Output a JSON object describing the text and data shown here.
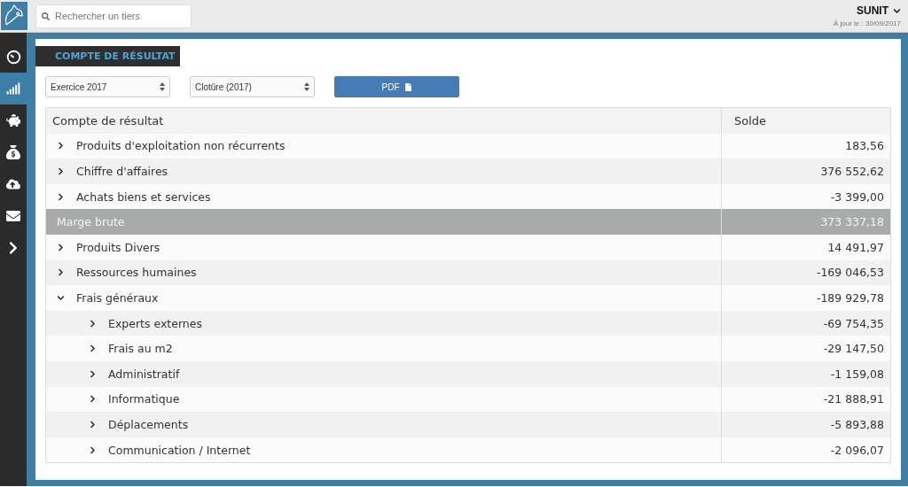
{
  "search": {
    "placeholder": "Rechercher un tiers"
  },
  "account": {
    "name": "SUNIT",
    "updated": "À jour le : 30/09/2017"
  },
  "sidebar": {
    "items": [
      {
        "kind": "dashboard",
        "selected": false
      },
      {
        "kind": "chart",
        "selected": true
      },
      {
        "kind": "savings",
        "selected": false
      },
      {
        "kind": "money",
        "selected": false
      },
      {
        "kind": "upload",
        "selected": false
      },
      {
        "kind": "mail",
        "selected": false
      },
      {
        "kind": "more",
        "selected": false
      }
    ]
  },
  "panel_title": "COMPTE DE RÉSULTAT",
  "filters": [
    {
      "value": "Exercice 2017"
    },
    {
      "value": "Clotûre (2017)"
    }
  ],
  "pdf_button": "PDF",
  "table": {
    "columns": [
      "Compte de résultat",
      "Solde"
    ],
    "rows": [
      {
        "kind": "group",
        "label": "Produits d'exploitation non récurrents",
        "value": "183,56",
        "expanded": false
      },
      {
        "kind": "group",
        "label": "Chiffre d'affaires",
        "value": "376 552,62",
        "expanded": false
      },
      {
        "kind": "group",
        "label": "Achats biens et services",
        "value": "-3 399,00",
        "expanded": false
      },
      {
        "kind": "subtotal",
        "label": "Marge brute",
        "value": "373 337,18"
      },
      {
        "kind": "group",
        "label": "Produits Divers",
        "value": "14 491,97",
        "expanded": false
      },
      {
        "kind": "group",
        "label": "Ressources humaines",
        "value": "-169 046,53",
        "expanded": false
      },
      {
        "kind": "group",
        "label": "Frais généraux",
        "value": "-189 929,78",
        "expanded": true,
        "children": [
          {
            "kind": "group",
            "label": "Experts externes",
            "value": "-69 754,35",
            "expanded": false
          },
          {
            "kind": "group",
            "label": "Frais au m2",
            "value": "-29 147,50",
            "expanded": false
          },
          {
            "kind": "group",
            "label": "Administratif",
            "value": "-1 159,08",
            "expanded": false
          },
          {
            "kind": "group",
            "label": "Informatique",
            "value": "-21 888,91",
            "expanded": false
          },
          {
            "kind": "group",
            "label": "Déplacements",
            "value": "-5 893,88",
            "expanded": false
          },
          {
            "kind": "group",
            "label": "Communication / Internet",
            "value": "-2 096,07",
            "expanded": false
          }
        ]
      }
    ]
  }
}
